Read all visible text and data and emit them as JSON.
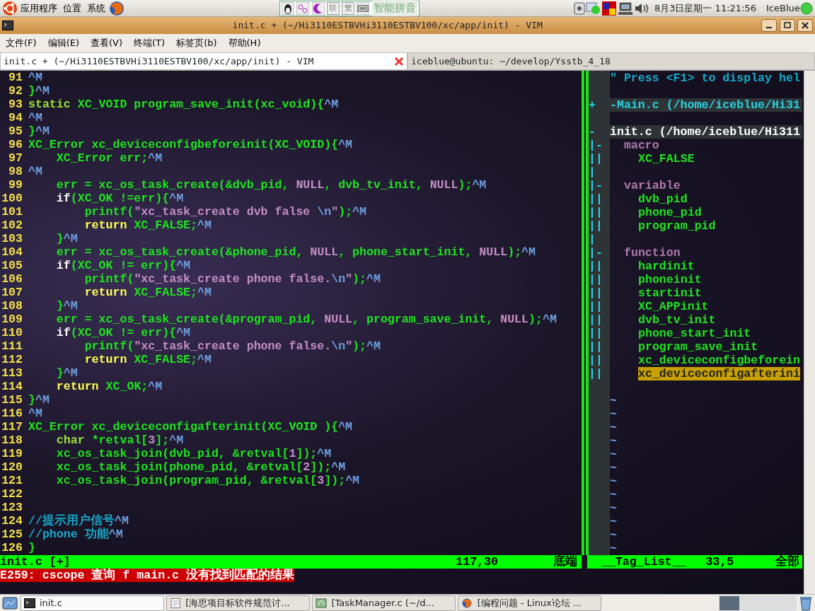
{
  "top_panel": {
    "menus": [
      "应用程序",
      "位置",
      "系统"
    ],
    "ime": {
      "keys": [
        "联",
        "繁"
      ],
      "label": "智能拼音"
    },
    "clock": "8月3日星期一 11:21:56",
    "user": "IceBlue"
  },
  "window": {
    "title": "init.c + (~/Hi3110ESTBVHi3110ESTBV100/xc/app/init) - VIM",
    "menu": [
      "文件(F)",
      "编辑(E)",
      "查看(V)",
      "终端(T)",
      "标签页(b)",
      "帮助(H)"
    ]
  },
  "tabs": [
    {
      "label": "init.c + (~/Hi3110ESTBVHi3110ESTBV100/xc/app/init) - VIM",
      "selected": true
    },
    {
      "label": "iceblue@ubuntu: ~/develop/Ysstb_4_18",
      "selected": false
    }
  ],
  "editor": {
    "lines": [
      {
        "num": "91",
        "segments": [
          {
            "kind": "special",
            "text": "^M"
          }
        ]
      },
      {
        "num": "92",
        "segments": [
          {
            "kind": "code",
            "text": "}"
          },
          {
            "kind": "special",
            "text": "^M"
          }
        ]
      },
      {
        "num": "93",
        "segments": [
          {
            "kind": "type",
            "text": "static"
          },
          {
            "kind": "code",
            "text": " XC_VOID program_save_init(xc_void){"
          },
          {
            "kind": "special",
            "text": "^M"
          }
        ]
      },
      {
        "num": "94",
        "segments": [
          {
            "kind": "special",
            "text": "^M"
          }
        ]
      },
      {
        "num": "95",
        "segments": [
          {
            "kind": "code",
            "text": "}"
          },
          {
            "kind": "special",
            "text": "^M"
          }
        ]
      },
      {
        "num": "96",
        "segments": [
          {
            "kind": "code",
            "text": "XC_Error xc_deviceconfigbeforeinit(XC_VOID){"
          },
          {
            "kind": "special",
            "text": "^M"
          }
        ]
      },
      {
        "num": "97",
        "segments": [
          {
            "kind": "code",
            "text": "    XC_Error err;"
          },
          {
            "kind": "special",
            "text": "^M"
          }
        ]
      },
      {
        "num": "98",
        "segments": [
          {
            "kind": "special",
            "text": "^M"
          }
        ]
      },
      {
        "num": "99",
        "segments": [
          {
            "kind": "code",
            "text": "    err = xc_os_task_create(&dvb_pid, "
          },
          {
            "kind": "constant",
            "text": "NULL"
          },
          {
            "kind": "code",
            "text": ", dvb_tv_init, "
          },
          {
            "kind": "constant",
            "text": "NULL"
          },
          {
            "kind": "code",
            "text": ");"
          },
          {
            "kind": "special",
            "text": "^M"
          }
        ]
      },
      {
        "num": "100",
        "segments": [
          {
            "kind": "plain",
            "text": "    if"
          },
          {
            "kind": "code",
            "text": "(XC_OK !=err){"
          },
          {
            "kind": "special",
            "text": "^M"
          }
        ]
      },
      {
        "num": "101",
        "segments": [
          {
            "kind": "code",
            "text": "        printf("
          },
          {
            "kind": "constant",
            "text": "\"xc_task_create dvb false "
          },
          {
            "kind": "special",
            "text": "\\n"
          },
          {
            "kind": "constant",
            "text": "\""
          },
          {
            "kind": "code",
            "text": ");"
          },
          {
            "kind": "special",
            "text": "^M"
          }
        ]
      },
      {
        "num": "102",
        "segments": [
          {
            "kind": "keyword",
            "text": "        return"
          },
          {
            "kind": "code",
            "text": " XC_FALSE;"
          },
          {
            "kind": "special",
            "text": "^M"
          }
        ]
      },
      {
        "num": "103",
        "segments": [
          {
            "kind": "code",
            "text": "    }"
          },
          {
            "kind": "special",
            "text": "^M"
          }
        ]
      },
      {
        "num": "104",
        "segments": [
          {
            "kind": "code",
            "text": "    err = xc_os_task_create(&phone_pid, "
          },
          {
            "kind": "constant",
            "text": "NULL"
          },
          {
            "kind": "code",
            "text": ", phone_start_init, "
          },
          {
            "kind": "constant",
            "text": "NULL"
          },
          {
            "kind": "code",
            "text": ");"
          },
          {
            "kind": "special",
            "text": "^M"
          }
        ]
      },
      {
        "num": "105",
        "segments": [
          {
            "kind": "plain",
            "text": "    if"
          },
          {
            "kind": "code",
            "text": "(XC_OK != err){"
          },
          {
            "kind": "special",
            "text": "^M"
          }
        ]
      },
      {
        "num": "106",
        "segments": [
          {
            "kind": "code",
            "text": "        printf("
          },
          {
            "kind": "constant",
            "text": "\"xc_task_create phone false."
          },
          {
            "kind": "special",
            "text": "\\n"
          },
          {
            "kind": "constant",
            "text": "\""
          },
          {
            "kind": "code",
            "text": ");"
          },
          {
            "kind": "special",
            "text": "^M"
          }
        ]
      },
      {
        "num": "107",
        "segments": [
          {
            "kind": "keyword",
            "text": "        return"
          },
          {
            "kind": "code",
            "text": " XC_FALSE;"
          },
          {
            "kind": "special",
            "text": "^M"
          }
        ]
      },
      {
        "num": "108",
        "segments": [
          {
            "kind": "code",
            "text": "    }"
          },
          {
            "kind": "special",
            "text": "^M"
          }
        ]
      },
      {
        "num": "109",
        "segments": [
          {
            "kind": "code",
            "text": "    err = xc_os_task_create(&program_pid, "
          },
          {
            "kind": "constant",
            "text": "NULL"
          },
          {
            "kind": "code",
            "text": ", program_save_init, "
          },
          {
            "kind": "constant",
            "text": "NULL"
          },
          {
            "kind": "code",
            "text": ");"
          },
          {
            "kind": "special",
            "text": "^M"
          }
        ]
      },
      {
        "num": "110",
        "segments": [
          {
            "kind": "plain",
            "text": "    if"
          },
          {
            "kind": "code",
            "text": "(XC_OK != err){"
          },
          {
            "kind": "special",
            "text": "^M"
          }
        ]
      },
      {
        "num": "111",
        "segments": [
          {
            "kind": "code",
            "text": "        printf("
          },
          {
            "kind": "constant",
            "text": "\"xc_task_create phone false."
          },
          {
            "kind": "special",
            "text": "\\n"
          },
          {
            "kind": "constant",
            "text": "\""
          },
          {
            "kind": "code",
            "text": ");"
          },
          {
            "kind": "special",
            "text": "^M"
          }
        ]
      },
      {
        "num": "112",
        "segments": [
          {
            "kind": "keyword",
            "text": "        return"
          },
          {
            "kind": "code",
            "text": " XC_FALSE;"
          },
          {
            "kind": "special",
            "text": "^M"
          }
        ]
      },
      {
        "num": "113",
        "segments": [
          {
            "kind": "code",
            "text": "    }"
          },
          {
            "kind": "special",
            "text": "^M"
          }
        ]
      },
      {
        "num": "114",
        "segments": [
          {
            "kind": "keyword",
            "text": "    return"
          },
          {
            "kind": "code",
            "text": " XC_OK;"
          },
          {
            "kind": "special",
            "text": "^M"
          }
        ]
      },
      {
        "num": "115",
        "segments": [
          {
            "kind": "code",
            "text": "}"
          },
          {
            "kind": "special",
            "text": "^M"
          }
        ]
      },
      {
        "num": "116",
        "segments": [
          {
            "kind": "special",
            "text": "^M"
          }
        ]
      },
      {
        "num": "117",
        "segments": [
          {
            "kind": "code",
            "text": "XC_Error xc_deviceconfigafterinit(XC_VOID ){"
          },
          {
            "kind": "special",
            "text": "^M"
          }
        ]
      },
      {
        "num": "118",
        "segments": [
          {
            "kind": "type",
            "text": "    char"
          },
          {
            "kind": "code",
            "text": " *retval["
          },
          {
            "kind": "constant",
            "text": "3"
          },
          {
            "kind": "code",
            "text": "];"
          },
          {
            "kind": "special",
            "text": "^M"
          }
        ]
      },
      {
        "num": "119",
        "segments": [
          {
            "kind": "code",
            "text": "    xc_os_task_join(dvb_pid, &retval["
          },
          {
            "kind": "constant",
            "text": "1"
          },
          {
            "kind": "code",
            "text": "]);"
          },
          {
            "kind": "special",
            "text": "^M"
          }
        ]
      },
      {
        "num": "120",
        "segments": [
          {
            "kind": "code",
            "text": "    xc_os_task_join(phone_pid, &retval["
          },
          {
            "kind": "constant",
            "text": "2"
          },
          {
            "kind": "code",
            "text": "]);"
          },
          {
            "kind": "special",
            "text": "^M"
          }
        ]
      },
      {
        "num": "121",
        "segments": [
          {
            "kind": "code",
            "text": "    xc_os_task_join(program_pid, &retval["
          },
          {
            "kind": "constant",
            "text": "3"
          },
          {
            "kind": "code",
            "text": "]);"
          },
          {
            "kind": "special",
            "text": "^M"
          }
        ]
      },
      {
        "num": "122"
      },
      {
        "num": "123"
      },
      {
        "num": "124",
        "segments": [
          {
            "kind": "comment",
            "text": "//提示用户信号"
          },
          {
            "kind": "special",
            "text": "^M"
          }
        ]
      },
      {
        "num": "125",
        "segments": [
          {
            "kind": "comment",
            "text": "//phone 功能"
          },
          {
            "kind": "special",
            "text": "^M"
          }
        ]
      },
      {
        "num": "126",
        "segments": [
          {
            "kind": "code",
            "text": "}"
          }
        ]
      }
    ]
  },
  "taglist": {
    "rows": [
      {
        "kind": "comment",
        "text": "\" Press <F1> to display hel"
      },
      {
        "kind": "blank"
      },
      {
        "kind": "file",
        "fold": "+",
        "text": "-Main.c (/home/iceblue/Hi31"
      },
      {
        "kind": "blank"
      },
      {
        "kind": "file_current",
        "fold": "-",
        "text": "init.c (/home/iceblue/Hi311"
      },
      {
        "kind": "group",
        "fold": "|-",
        "text": "macro"
      },
      {
        "kind": "tag",
        "fold": "||",
        "text": "XC_FALSE",
        "selected": false
      },
      {
        "kind": "blank",
        "fold": "|"
      },
      {
        "kind": "group",
        "fold": "|-",
        "text": "variable"
      },
      {
        "kind": "tag",
        "fold": "||",
        "text": "dvb_pid",
        "selected": false
      },
      {
        "kind": "tag",
        "fold": "||",
        "text": "phone_pid",
        "selected": false
      },
      {
        "kind": "tag",
        "fold": "||",
        "text": "program_pid",
        "selected": false
      },
      {
        "kind": "blank",
        "fold": "|"
      },
      {
        "kind": "group",
        "fold": "|-",
        "text": "function"
      },
      {
        "kind": "tag",
        "fold": "||",
        "text": "hardinit",
        "selected": false
      },
      {
        "kind": "tag",
        "fold": "||",
        "text": "phoneinit",
        "selected": false
      },
      {
        "kind": "tag",
        "fold": "||",
        "text": "startinit",
        "selected": false
      },
      {
        "kind": "tag",
        "fold": "||",
        "text": "XC_APPinit",
        "selected": false
      },
      {
        "kind": "tag",
        "fold": "||",
        "text": "dvb_tv_init",
        "selected": false
      },
      {
        "kind": "tag",
        "fold": "||",
        "text": "phone_start_init",
        "selected": false
      },
      {
        "kind": "tag",
        "fold": "||",
        "text": "program_save_init",
        "selected": false
      },
      {
        "kind": "tag",
        "fold": "||",
        "text": "xc_deviceconfigbeforein",
        "selected": false
      },
      {
        "kind": "tag",
        "fold": "||",
        "text": "xc_deviceconfigafterini",
        "selected": true
      },
      {
        "kind": "blank"
      },
      {
        "kind": "tilde",
        "text": "~"
      },
      {
        "kind": "tilde",
        "text": "~"
      },
      {
        "kind": "tilde",
        "text": "~"
      },
      {
        "kind": "tilde",
        "text": "~"
      },
      {
        "kind": "tilde",
        "text": "~"
      },
      {
        "kind": "tilde",
        "text": "~"
      },
      {
        "kind": "tilde",
        "text": "~"
      },
      {
        "kind": "tilde",
        "text": "~"
      },
      {
        "kind": "tilde",
        "text": "~"
      },
      {
        "kind": "tilde",
        "text": "~"
      },
      {
        "kind": "tilde",
        "text": "~"
      },
      {
        "kind": "tilde",
        "text": "~"
      }
    ]
  },
  "status": {
    "left": {
      "file": "init.c [+]",
      "ruler": "117,30",
      "position": "底端"
    },
    "right": {
      "name": "__Tag_List__",
      "ruler": "33,5",
      "position": "全部"
    }
  },
  "message": "E259: cscope 查询 f main.c 没有找到匹配的结果",
  "taskbar": {
    "items": [
      {
        "label": "init.c",
        "selected": true
      },
      {
        "label": "[海思项目标软件规范讨...",
        "selected": false
      },
      {
        "label": "[TaskManager.c (~/d...",
        "selected": false
      },
      {
        "label": "[编程问题 - Linux论坛 ...",
        "selected": false
      }
    ]
  }
}
